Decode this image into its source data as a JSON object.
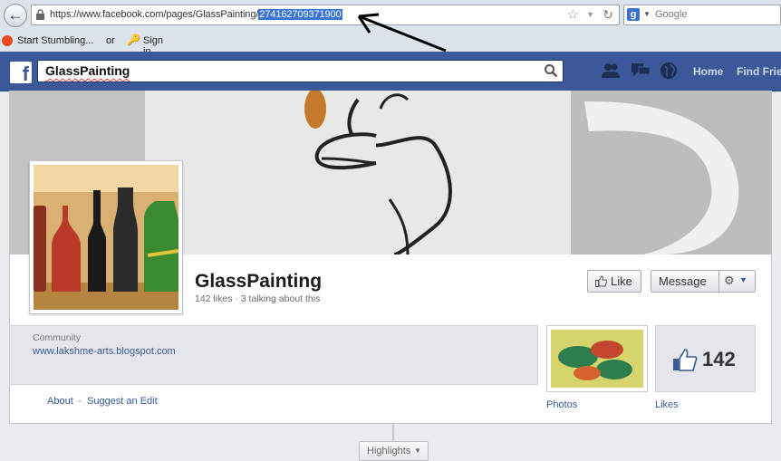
{
  "browser": {
    "url_prefix": "https://www.facebook.com/pages/GlassPainting/",
    "url_selected": "274162709371900",
    "search_engine_placeholder": "Google",
    "bookmarks": {
      "stumble": "Start Stumbling...",
      "or": "or",
      "signin": "Sign in"
    }
  },
  "fb": {
    "search_value": "GlassPainting",
    "nav": {
      "home": "Home",
      "find_friends": "Find Frie"
    },
    "colors": {
      "brand": "#3b5998",
      "link": "#3b5998"
    }
  },
  "page": {
    "name": "GlassPainting",
    "stats": "142 likes · 3 talking about this",
    "buttons": {
      "like": "Like",
      "message": "Message"
    },
    "about": {
      "category": "Community",
      "website": "www.lakshme-arts.blogspot.com",
      "about_link": "About",
      "separator": "-",
      "suggest_link": "Suggest an Edit"
    },
    "tiles": {
      "photos_label": "Photos",
      "likes_count": "142",
      "likes_label": "Likes"
    },
    "timeline": {
      "highlights": "Highlights"
    }
  },
  "icons": {
    "back": "back-arrow-icon",
    "lock": "lock-icon",
    "bookmark_star": "star-icon",
    "reload": "reload-icon",
    "search": "search-icon",
    "friends": "friend-requests-icon",
    "messages": "messages-icon",
    "notifications": "globe-icon",
    "like": "thumbs-up-icon",
    "settings": "gear-icon"
  }
}
